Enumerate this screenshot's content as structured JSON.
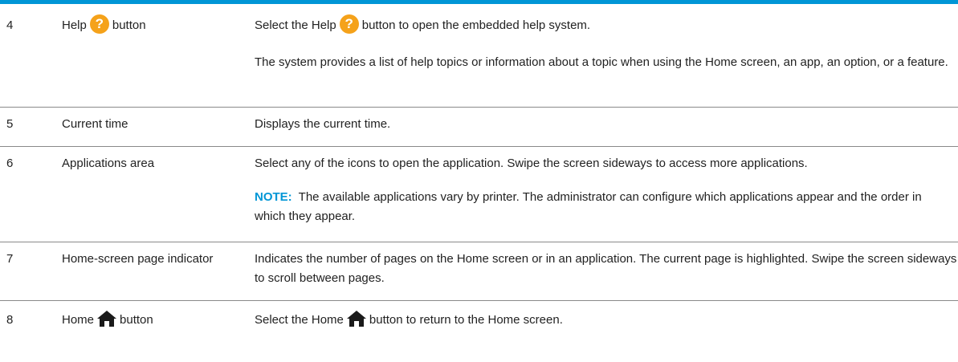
{
  "rows": [
    {
      "number": "4",
      "item_before": "Help",
      "item_after": "button",
      "icon": "help-icon",
      "desc_before": "Select the Help",
      "desc_after": "button to open the embedded help system.",
      "desc_2": "The system provides a list of help topics or information about a topic when using the Home screen, an app, an option, or a feature."
    },
    {
      "number": "5",
      "item": "Current time",
      "desc": "Displays the current time."
    },
    {
      "number": "6",
      "item": "Applications area",
      "desc": "Select any of the icons to open the application. Swipe the screen sideways to access more applications.",
      "note_label": "NOTE:",
      "note_text": "The available applications vary by printer. The administrator can configure which applications appear and the order in which they appear."
    },
    {
      "number": "7",
      "item": "Home-screen page indicator",
      "desc": "Indicates the number of pages on the Home screen or in an application. The current page is highlighted. Swipe the screen sideways to scroll between pages."
    },
    {
      "number": "8",
      "item_before": "Home",
      "item_after": "button",
      "icon": "home-icon",
      "desc_before": "Select the Home",
      "desc_after": "button to return to the Home screen."
    }
  ],
  "colors": {
    "accent": "#0096d6",
    "help_icon": "#f5a21a",
    "home_icon": "#1a1a1a"
  }
}
